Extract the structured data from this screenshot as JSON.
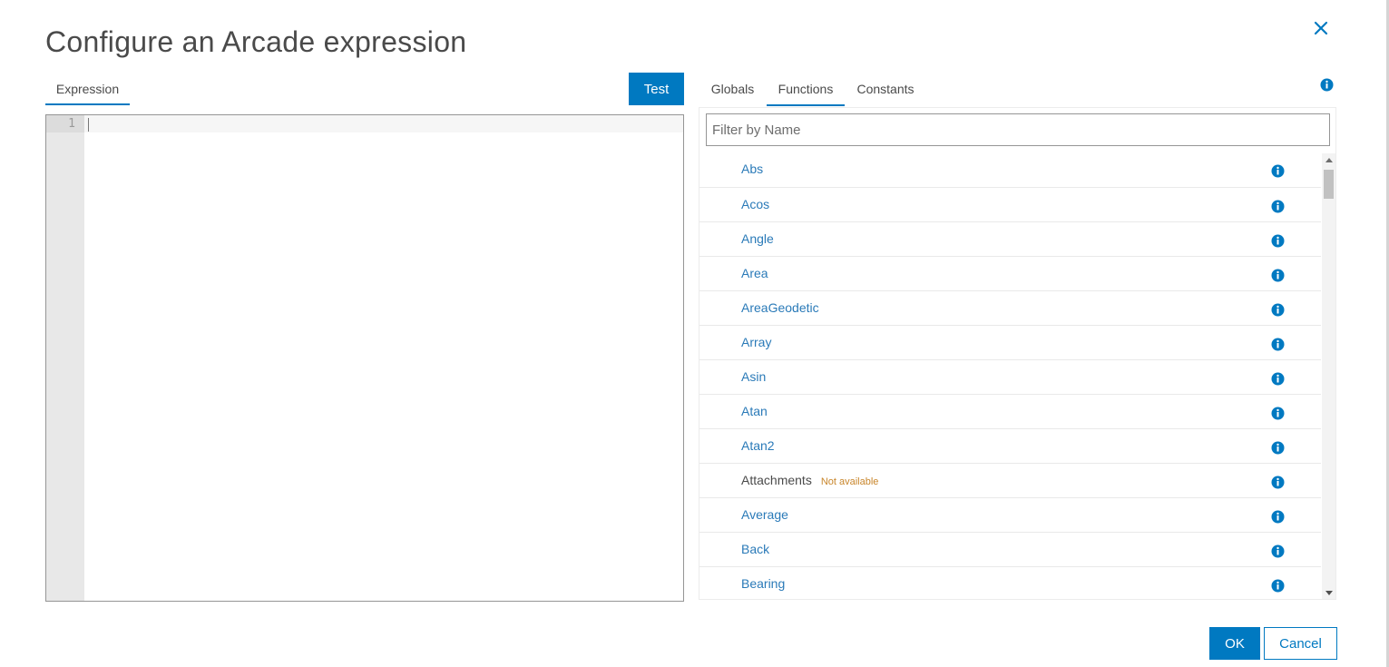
{
  "dialog": {
    "title": "Configure an Arcade expression"
  },
  "editor": {
    "tab_label": "Expression",
    "test_label": "Test",
    "line_numbers": [
      "1"
    ]
  },
  "reference": {
    "tabs": [
      {
        "label": "Globals"
      },
      {
        "label": "Functions",
        "active": true
      },
      {
        "label": "Constants"
      }
    ],
    "filter_placeholder": "Filter by Name",
    "functions": [
      {
        "name": "Abs"
      },
      {
        "name": "Acos"
      },
      {
        "name": "Angle"
      },
      {
        "name": "Area"
      },
      {
        "name": "AreaGeodetic"
      },
      {
        "name": "Array"
      },
      {
        "name": "Asin"
      },
      {
        "name": "Atan"
      },
      {
        "name": "Atan2"
      },
      {
        "name": "Attachments",
        "status": "Not available"
      },
      {
        "name": "Average"
      },
      {
        "name": "Back"
      },
      {
        "name": "Bearing"
      }
    ]
  },
  "footer": {
    "ok_label": "OK",
    "cancel_label": "Cancel"
  },
  "colors": {
    "accent": "#0079c1",
    "link": "#2a7ab8",
    "unavailable": "#c8852a"
  },
  "icons": {
    "close": "close-icon",
    "info": "info-icon",
    "scroll_up": "chevron-up-icon",
    "scroll_down": "chevron-down-icon"
  }
}
